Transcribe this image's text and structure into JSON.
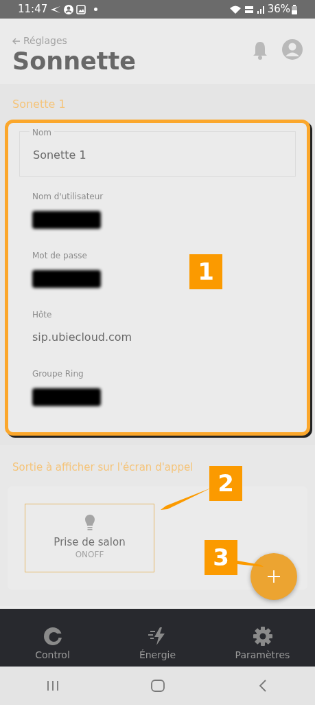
{
  "status_bar": {
    "time": "11:47",
    "battery": "36%"
  },
  "header": {
    "back_label": "Réglages",
    "title": "Sonnette"
  },
  "device_section": {
    "title": "Sonette 1",
    "fields": [
      {
        "kind": "outlined",
        "label": "Nom",
        "value": "Sonette 1"
      },
      {
        "kind": "plain",
        "label": "Nom d'utilisateur",
        "redacted": true
      },
      {
        "kind": "plain",
        "label": "Mot de passe",
        "redacted": true
      },
      {
        "kind": "plain",
        "label": "Hôte",
        "value": "sip.ubiecloud.com"
      },
      {
        "kind": "plain",
        "label": "Groupe Ring",
        "redacted": true
      }
    ]
  },
  "output_section": {
    "title": "Sortie à afficher sur l'écran d'appel",
    "outputs": [
      {
        "name": "Prise de salon",
        "type": "ONOFF"
      }
    ]
  },
  "annotations": [
    "1",
    "2",
    "3"
  ],
  "bottom_nav": [
    {
      "label": "Control",
      "kind": "control"
    },
    {
      "label": "Énergie",
      "kind": "energy"
    },
    {
      "label": "Paramètres",
      "kind": "settings"
    }
  ]
}
